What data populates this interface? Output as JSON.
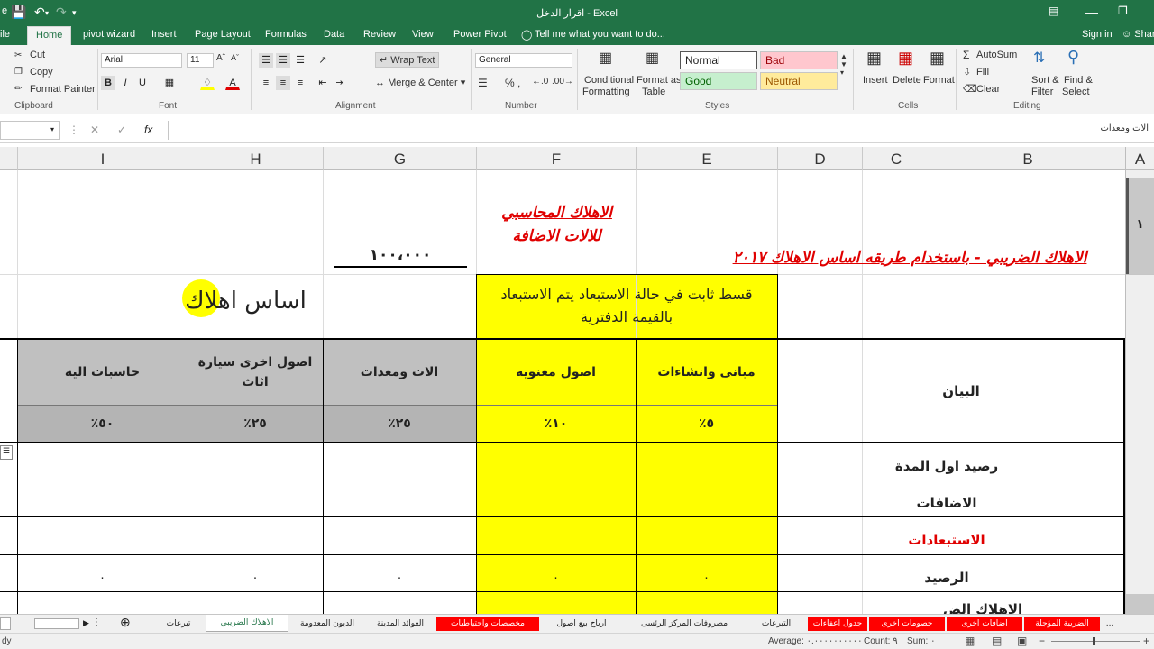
{
  "window": {
    "title": "اقرار الدخل - Excel",
    "sign_in": "Sign in",
    "share": "Shar"
  },
  "tabs": [
    "ile",
    "Home",
    "pivot wizard",
    "Insert",
    "Page Layout",
    "Formulas",
    "Data",
    "Review",
    "View",
    "Power Pivot"
  ],
  "tell_me": "Tell me what you want to do...",
  "ribbon": {
    "clipboard": {
      "cut": "Cut",
      "copy": "Copy",
      "format_painter": "Format Painter",
      "label": "Clipboard"
    },
    "font": {
      "name": "Arial",
      "size": "11",
      "label": "Font"
    },
    "alignment": {
      "wrap": "Wrap Text",
      "merge": "Merge & Center",
      "label": "Alignment"
    },
    "number": {
      "format": "General",
      "label": "Number",
      "symbols": "% ,"
    },
    "styles": {
      "cond1": "Conditional",
      "cond2": "Formatting",
      "fmt1": "Format as",
      "fmt2": "Table",
      "normal": "Normal",
      "bad": "Bad",
      "good": "Good",
      "neutral": "Neutral",
      "label": "Styles"
    },
    "cells": {
      "insert": "Insert",
      "delete": "Delete",
      "format": "Format",
      "label": "Cells"
    },
    "editing": {
      "autosum": "AutoSum",
      "fill": "Fill",
      "clear": "Clear",
      "sort1": "Sort &",
      "sort2": "Filter",
      "find1": "Find &",
      "find2": "Select",
      "label": "Editing"
    }
  },
  "formula_bar": {
    "fx": "fx",
    "content": "الات ومعدات"
  },
  "columns": [
    "I",
    "H",
    "G",
    "F",
    "E",
    "D",
    "C",
    "B",
    "A"
  ],
  "sheet": {
    "row_num": "١",
    "title_red": "الاهلاك الضريبي - باستخدام طريقه اساس الاهلاك ٢٠١٧",
    "acc_dep_line1": "الاهلاك المحاسبي",
    "acc_dep_line2": "للالات الاضافة",
    "amount": "١٠٠،٠٠٠",
    "installment_note": "قسط ثابت في حالة الاستبعاد يتم الاستبعاد بالقيمة الدفترية",
    "basis_title": "اساس اهلاك",
    "header_statement": "البيان",
    "categories": [
      "مبانى وانشاءات",
      "اصول معنوية",
      "الات ومعدات",
      "اصول اخرى سيارة اثاث",
      "حاسبات اليه"
    ],
    "rates": [
      "٥٪",
      "١٠٪",
      "٢٥٪",
      "٢٥٪",
      "٥٠٪"
    ],
    "rows": [
      "رصيد اول المدة",
      "الاضافات",
      "الاستبعادات",
      "الرصيد"
    ],
    "zeros": [
      "٠",
      "٠",
      "٠",
      "٠",
      "٠"
    ],
    "cut_row": "الاهلاك الض"
  },
  "sheet_tabs": [
    "...",
    "الضريبة المؤجلة",
    "اضافات اخرى",
    "خصومات اخرى",
    "جدول اعفاءات",
    "التبرعات",
    "مصروفات المركز الرئسى",
    "ارباح بيع اصول",
    "مخصصات واحتياطيات",
    "العوائد المدينة",
    "الديون المعدومة",
    "الاهلاك الضريبي",
    "تبرعات"
  ],
  "status": {
    "ready": "dy",
    "average": "Average: ٠.٠٠٠٠٠٠٠٠٠٠",
    "count": "Count: ٩",
    "sum": "Sum: ٠"
  },
  "colors": {
    "excel_green": "#217346",
    "yellow": "#ffff00",
    "gray_fill": "#c0c0c0",
    "red_text": "#e00000",
    "red_tab": "#ff0000"
  }
}
